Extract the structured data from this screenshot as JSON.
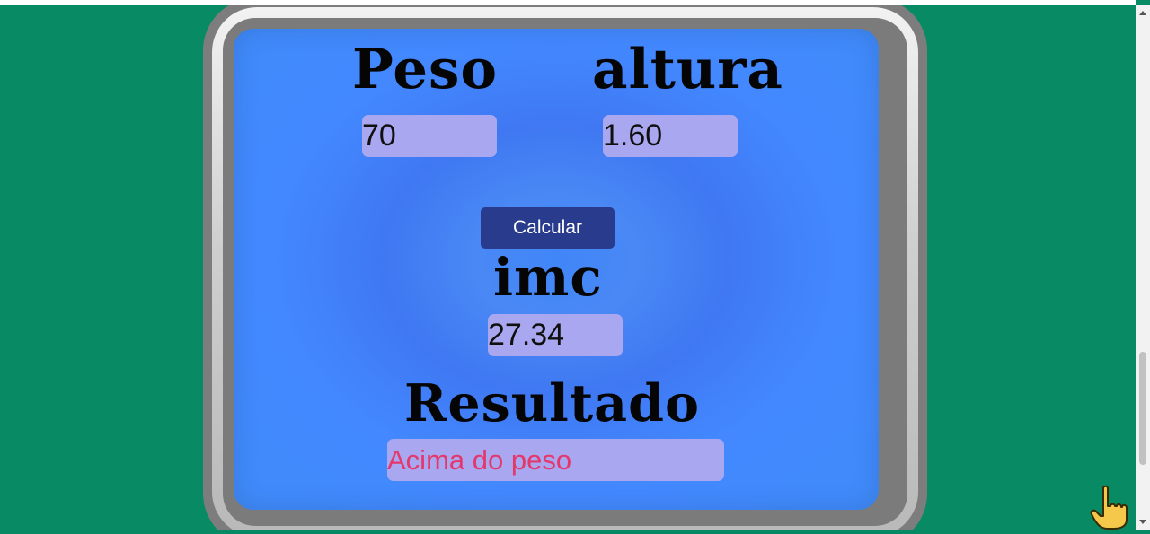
{
  "calculator": {
    "peso_label": "Peso",
    "peso_value": "70",
    "altura_label": "altura",
    "altura_value": "1.60",
    "calcular_button": "Calcular",
    "imc_label": "imc",
    "imc_value": "27.34",
    "resultado_label": "Resultado",
    "resultado_value": "Acima do peso"
  },
  "icons": {
    "cursor": "hand-pointer-icon",
    "scroll_up": "scroll-up-arrow-icon",
    "scroll_down": "scroll-down-arrow-icon"
  },
  "colors": {
    "page_background": "#088a64",
    "screen_blue": "#4388ff",
    "field_background": "#a9a7ef",
    "button_background": "#283b8c",
    "result_text": "#e4386d"
  }
}
